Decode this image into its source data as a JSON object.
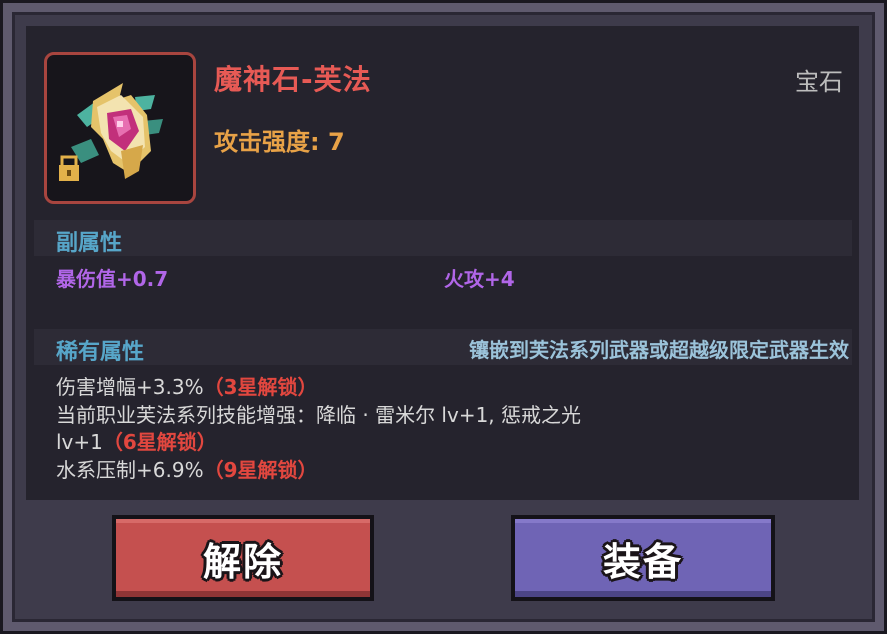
{
  "item": {
    "name": "魔神石-芙法",
    "type": "宝石",
    "attack": "攻击强度: 7",
    "icon": "gem-crown-icon",
    "locked": true
  },
  "sub_attributes": {
    "title": "副属性",
    "stats": [
      "暴伤值+0.7",
      "火攻+4"
    ]
  },
  "rare_attributes": {
    "title": "稀有属性",
    "note": "镶嵌到芙法系列武器或超越级限定武器生效",
    "lines": [
      {
        "text": "伤害增幅+3.3%",
        "lock": "（3星解锁）"
      },
      {
        "text": "当前职业芙法系列技能增强：降临 · 雷米尔 lv+1, 惩戒之光",
        "lock": ""
      },
      {
        "text": "lv+1",
        "lock": "（6星解锁）"
      },
      {
        "text": "水系压制+6.9%",
        "lock": "（9星解锁）"
      }
    ]
  },
  "buttons": {
    "unequip": "解除",
    "equip": "装备"
  },
  "colors": {
    "name": "#e75a55",
    "attack": "#e8a247",
    "section": "#57a6c9",
    "purple_stat": "#b166e8",
    "lock": "#e2473f",
    "unequip_button": "#c5504f",
    "equip_button": "#6f64b5"
  }
}
